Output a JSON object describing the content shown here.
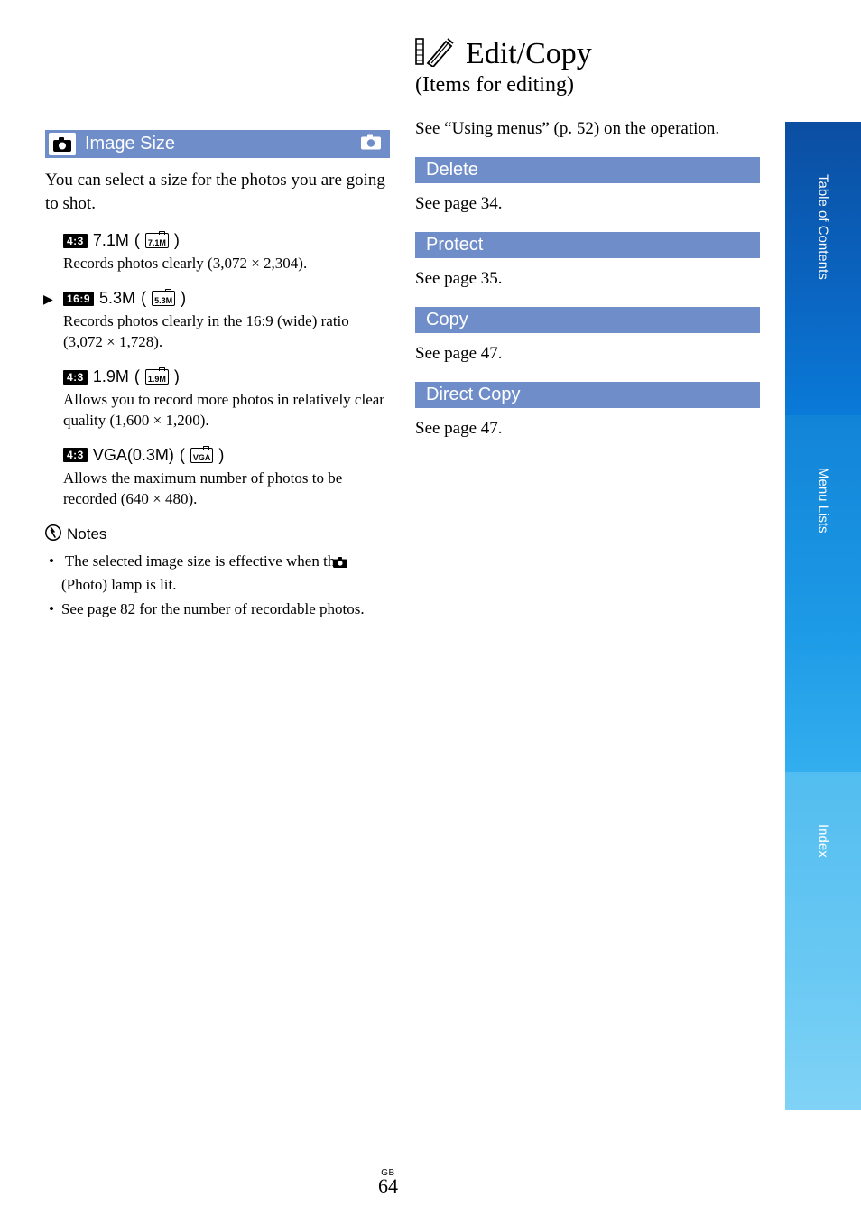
{
  "sidetabs": {
    "toc": "Table of Contents",
    "menu": "Menu Lists",
    "index": "Index"
  },
  "left": {
    "section_title": "Image Size",
    "intro": "You can select a size for the photos you are going to shot.",
    "options": [
      {
        "ratio": "4:3",
        "label": "7.1M",
        "icon_text": "7.1M",
        "desc": "Records photos clearly (3,072 × 2,304)."
      },
      {
        "default": true,
        "ratio": "16:9",
        "label": "5.3M",
        "icon_text": "5.3M",
        "desc": "Records photos clearly in the 16:9 (wide) ratio (3,072 × 1,728)."
      },
      {
        "ratio": "4:3",
        "label": "1.9M",
        "icon_text": "1.9M",
        "desc": "Allows you to record more photos in relatively clear quality (1,600 × 1,200)."
      },
      {
        "ratio": "4:3",
        "label": "VGA(0.3M)",
        "icon_text": "VGA",
        "desc": "Allows the maximum number of photos to be recorded (640 × 480)."
      }
    ],
    "notes_heading": "Notes",
    "notes": {
      "n1a": "The selected image size is effective when the ",
      "n1b": " (Photo) lamp is lit.",
      "n2": "See page 82 for the number of recordable photos."
    }
  },
  "right": {
    "title": "Edit/Copy",
    "subtitle": "(Items for editing)",
    "intro": "See “Using menus” (p. 52) on the operation.",
    "sections": [
      {
        "title": "Delete",
        "ref": "See page 34."
      },
      {
        "title": "Protect",
        "ref": "See page 35."
      },
      {
        "title": "Copy",
        "ref": "See page 47."
      },
      {
        "title": "Direct Copy",
        "ref": "See page 47."
      }
    ]
  },
  "footer": {
    "region": "GB",
    "page": "64"
  }
}
